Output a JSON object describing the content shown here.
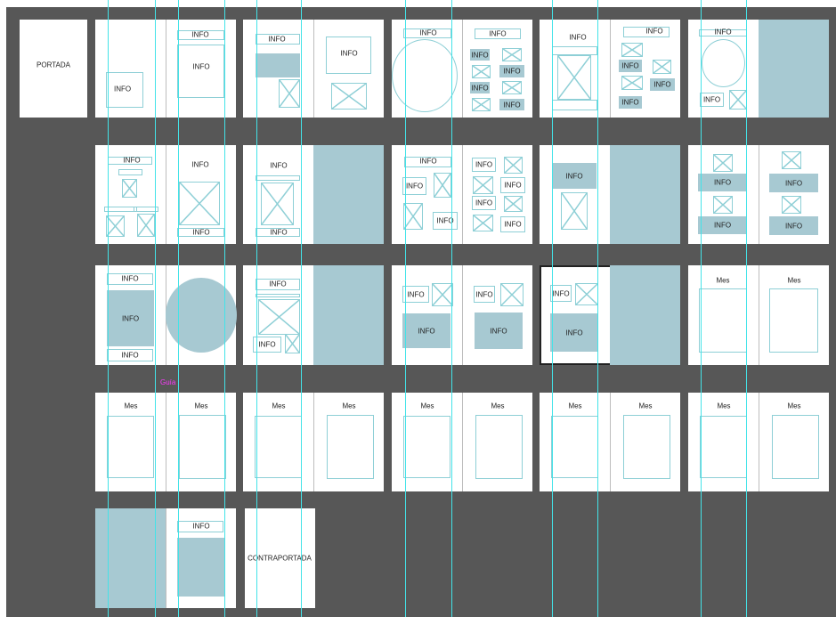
{
  "colors": {
    "pasteboard": "#575757",
    "fill": "#a7c9d2",
    "frame": "#8ecfd6",
    "guide": "#43e3e8",
    "selection": "#222222",
    "guide_label": "#ff38ff"
  },
  "text": {
    "cover": "PORTADA",
    "back_cover": "CONTRAPORTADA",
    "info": "INFO",
    "month": "Mes",
    "guide": "Guía"
  }
}
